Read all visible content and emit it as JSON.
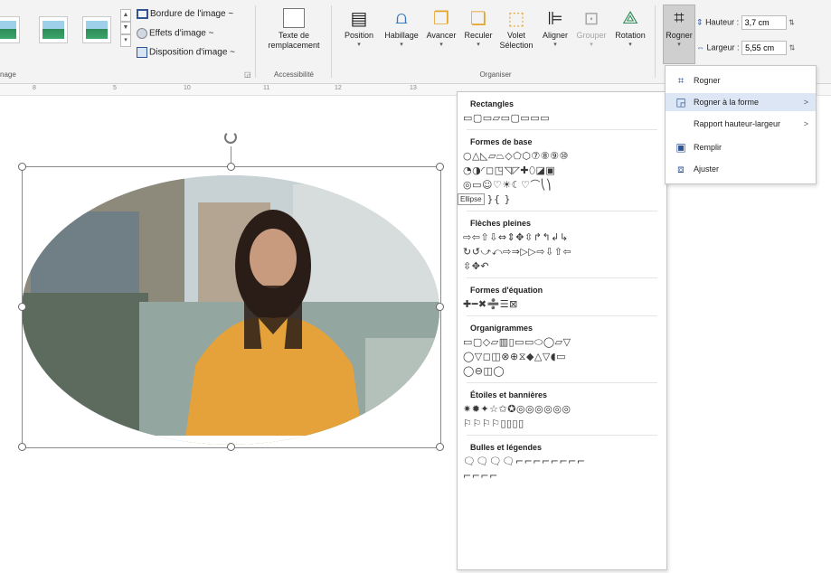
{
  "ribbon": {
    "image_styles_group_label": "nage",
    "image_commands": {
      "border": "Bordure de l'image ~",
      "effects": "Effets d'image ~",
      "layout": "Disposition d'image ~"
    },
    "accessibility": {
      "alt_text_label_line1": "Texte de",
      "alt_text_label_line2": "remplacement",
      "group_label": "Accessibilité"
    },
    "arrange": {
      "group_label": "Organiser",
      "position": "Position",
      "wrap": "Habillage",
      "forward": "Avancer",
      "backward": "Reculer",
      "pane_line1": "Volet",
      "pane_line2": "Sélection",
      "align": "Aligner",
      "group": "Grouper",
      "rotate": "Rotation"
    },
    "size": {
      "crop_label": "Rogner",
      "height_label": "Hauteur :",
      "height_value": "3,7 cm",
      "width_label": "Largeur :",
      "width_value": "5,55 cm"
    }
  },
  "ruler": {
    "marks": [
      "8",
      "5",
      "10",
      "11",
      "12",
      "13"
    ]
  },
  "shapes_menu": {
    "sections": [
      {
        "title": "Rectangles",
        "rows": [
          "▭▢▭▱▭▢▭▭▭"
        ]
      },
      {
        "title": "Formes de base",
        "rows": [
          "○△◺▱⏢◇⬠⬡⑦⑧⑨⑩",
          "◔◑◜◻◳◹◸✚⬯◪▣",
          "◎▭☺♡☀☾♡⌒⎝⎞",
          "{}{ }{ }"
        ]
      },
      {
        "title": "Flèches pleines",
        "rows": [
          "⇨⇦⇧⇩⇔⇕✥⇳↱↰↲↳",
          "↻↺⤻⤺⇨⇒▷▷⇨⇩⇧⇦",
          "⇳✥↶"
        ]
      },
      {
        "title": "Formes d'équation",
        "rows": [
          "✚━✖➗☰⊠"
        ]
      },
      {
        "title": "Organigrammes",
        "rows": [
          "▭▢◇▱▥▯▭▭⬭◯▱▽",
          "◯▽◻◫⊗⊕⧖◆△▽◖▭",
          "◯⊖◫◯"
        ]
      },
      {
        "title": "Étoiles et bannières",
        "rows": [
          "✷✹✦☆✩✪◎◎◎◎◎◎",
          "⚐⚐⚐⚐▯▯▯▯"
        ]
      },
      {
        "title": "Bulles et légendes",
        "rows": [
          "🗨🗨🗨🗨⌐⌐⌐⌐⌐⌐⌐⌐",
          "⌐⌐⌐⌐"
        ]
      }
    ],
    "tooltip": "Ellipse"
  },
  "crop_submenu": {
    "items": [
      {
        "label": "Rogner",
        "icon": "crop-icon",
        "arrow": ""
      },
      {
        "label": "Rogner à la forme",
        "icon": "crop-to-shape-icon",
        "arrow": ">"
      },
      {
        "label": "Rapport hauteur-largeur",
        "icon": "",
        "arrow": ">"
      },
      {
        "label": "Remplir",
        "icon": "fill-icon",
        "arrow": ""
      },
      {
        "label": "Ajuster",
        "icon": "fit-icon",
        "arrow": ""
      }
    ]
  },
  "colors": {
    "ribbon_bg": "#f3f3f3",
    "menu_highlight": "#dce6f4",
    "accent": "#2f5597",
    "button_selected": "#cfcfcf"
  }
}
